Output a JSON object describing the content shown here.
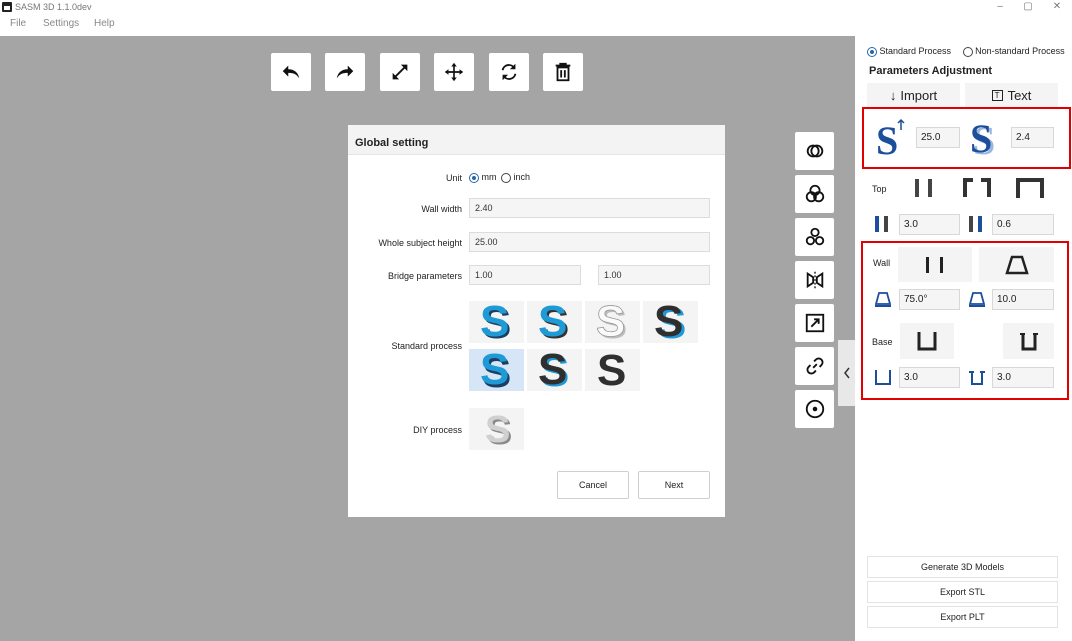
{
  "app": {
    "title": "SASM 3D 1.1.0dev"
  },
  "window_controls": {
    "minimize": "–",
    "maximize": "▢",
    "close": "✕"
  },
  "menu": [
    "File",
    "Settings",
    "Help"
  ],
  "toolbar": [
    {
      "name": "undo-button",
      "icon": "undo-icon"
    },
    {
      "name": "redo-button",
      "icon": "redo-icon"
    },
    {
      "name": "scale-button",
      "icon": "scale-arrows-icon"
    },
    {
      "name": "move-button",
      "icon": "move-icon"
    },
    {
      "name": "rotate-button",
      "icon": "rotate-icon"
    },
    {
      "name": "delete-button",
      "icon": "trash-icon"
    }
  ],
  "side_tools": [
    {
      "name": "boolean-ops-button",
      "icon": "overlap-rings-icon"
    },
    {
      "name": "union-button",
      "icon": "triple-circles-icon"
    },
    {
      "name": "pattern-button",
      "icon": "stacked-circles-icon"
    },
    {
      "name": "mirror-button",
      "icon": "mirror-icon"
    },
    {
      "name": "fit-button",
      "icon": "resize-frame-icon"
    },
    {
      "name": "link-button",
      "icon": "link-icon"
    },
    {
      "name": "center-button",
      "icon": "target-icon"
    }
  ],
  "dialog": {
    "title": "Global setting",
    "unit_label": "Unit",
    "unit_options": [
      "mm",
      "inch"
    ],
    "unit_selected": "mm",
    "wall_width_label": "Wall width",
    "wall_width_value": "2.40",
    "height_label": "Whole subject  height",
    "height_value": "25.00",
    "bridge_label": "Bridge  parameters",
    "bridge_value_1": "1.00",
    "bridge_value_2": "1.00",
    "standard_label": "Standard process",
    "diy_label": "DIY process",
    "cancel_label": "Cancel",
    "next_label": "Next"
  },
  "panel": {
    "process_options": [
      "Standard Process",
      "Non-standard Process"
    ],
    "process_selected": "Standard Process",
    "heading": "Parameters Adjustment",
    "import_label": "Import",
    "text_label": "Text",
    "height_value": "25.0",
    "wall_value": "2.4",
    "top_label": "Top",
    "top_value_1": "3.0",
    "top_value_2": "0.6",
    "wall_label": "Wall",
    "wall_angle": "75.0°",
    "wall_offset": "10.0",
    "base_label": "Base",
    "base_value_1": "3.0",
    "base_value_2": "3.0",
    "generate_label": "Generate 3D Models",
    "export_stl_label": "Export STL",
    "export_plt_label": "Export PLT"
  },
  "colors": {
    "canvas": "#a5a5a5",
    "accent_blue": "#2867a8",
    "s_blue": "#1e9ad6",
    "s_dark": "#2f2f2f",
    "highlight_red": "#e10000"
  }
}
